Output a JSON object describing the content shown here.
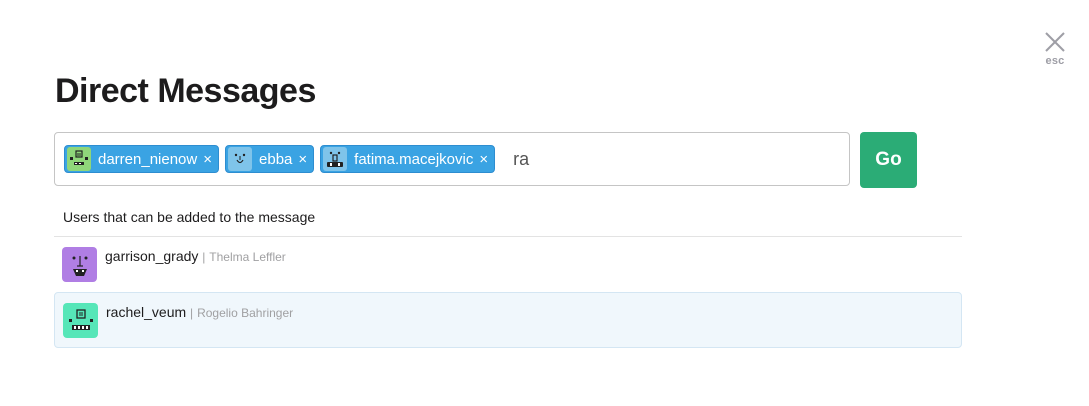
{
  "dialog": {
    "title": "Direct Messages",
    "close_hint": "esc"
  },
  "recipients": [
    {
      "name": "darren_nienow",
      "remove_glyph": "×",
      "avatar_color": "#8fd67a"
    },
    {
      "name": "ebba",
      "remove_glyph": "×",
      "avatar_color": "#7fc4ea"
    },
    {
      "name": "fatima.macejkovic",
      "remove_glyph": "×",
      "avatar_color": "#7fc4ea"
    }
  ],
  "search": {
    "value": "ra"
  },
  "go_button": {
    "label": "Go",
    "color": "#2bac76"
  },
  "results": {
    "heading": "Users that can be added to the message",
    "items": [
      {
        "username": "garrison_grady",
        "separator": "|",
        "real_name": "Thelma Leffler",
        "avatar_color": "#b07ee4",
        "highlighted": false
      },
      {
        "username": "rachel_veum",
        "separator": "|",
        "real_name": "Rogelio Bahringer",
        "avatar_color": "#56e6b8",
        "highlighted": true
      }
    ]
  },
  "colors": {
    "chip": "#3aa3e3",
    "highlight_row": "#f0f7fc"
  },
  "icons": {
    "close": "close-icon",
    "chip_remove": "x-icon",
    "avatar": "robot-face-icon"
  }
}
